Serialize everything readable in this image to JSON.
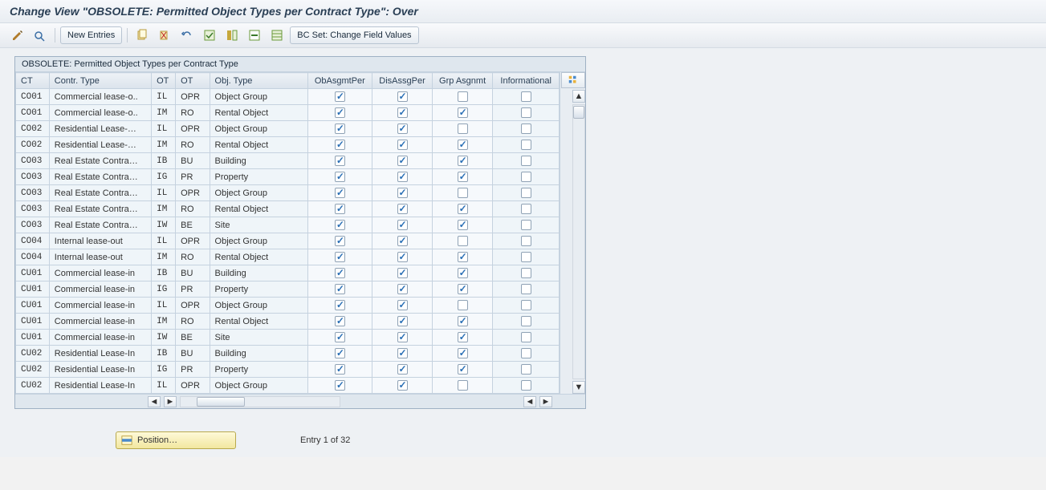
{
  "title": "Change View \"OBSOLETE: Permitted Object Types per Contract Type\": Over",
  "toolbar": {
    "new_entries": "New Entries",
    "bcset": "BC Set: Change Field Values"
  },
  "panel_title": "OBSOLETE: Permitted Object Types per Contract Type",
  "columns": {
    "ct": "CT",
    "contr_type": "Contr. Type",
    "ot1": "OT",
    "ot2": "OT",
    "obj_type": "Obj. Type",
    "obAsgmtPer": "ObAsgmtPer",
    "disAssgPer": "DisAssgPer",
    "grpAsgnmt": "Grp Asgnmt",
    "informational": "Informational"
  },
  "rows": [
    {
      "ct": "CO01",
      "ctype": "Commercial lease-o..",
      "ot1": "IL",
      "ot2": "OPR",
      "otype": "Object Group",
      "c1": true,
      "c2": true,
      "c3": false,
      "c4": false
    },
    {
      "ct": "CO01",
      "ctype": "Commercial lease-o..",
      "ot1": "IM",
      "ot2": "RO",
      "otype": "Rental Object",
      "c1": true,
      "c2": true,
      "c3": true,
      "c4": false
    },
    {
      "ct": "CO02",
      "ctype": "Residential Lease-…",
      "ot1": "IL",
      "ot2": "OPR",
      "otype": "Object Group",
      "c1": true,
      "c2": true,
      "c3": false,
      "c4": false
    },
    {
      "ct": "CO02",
      "ctype": "Residential Lease-…",
      "ot1": "IM",
      "ot2": "RO",
      "otype": "Rental Object",
      "c1": true,
      "c2": true,
      "c3": true,
      "c4": false
    },
    {
      "ct": "CO03",
      "ctype": "Real Estate Contra…",
      "ot1": "IB",
      "ot2": "BU",
      "otype": "Building",
      "c1": true,
      "c2": true,
      "c3": true,
      "c4": false
    },
    {
      "ct": "CO03",
      "ctype": "Real Estate Contra…",
      "ot1": "IG",
      "ot2": "PR",
      "otype": "Property",
      "c1": true,
      "c2": true,
      "c3": true,
      "c4": false
    },
    {
      "ct": "CO03",
      "ctype": "Real Estate Contra…",
      "ot1": "IL",
      "ot2": "OPR",
      "otype": "Object Group",
      "c1": true,
      "c2": true,
      "c3": false,
      "c4": false
    },
    {
      "ct": "CO03",
      "ctype": "Real Estate Contra…",
      "ot1": "IM",
      "ot2": "RO",
      "otype": "Rental Object",
      "c1": true,
      "c2": true,
      "c3": true,
      "c4": false
    },
    {
      "ct": "CO03",
      "ctype": "Real Estate Contra…",
      "ot1": "IW",
      "ot2": "BE",
      "otype": "Site",
      "c1": true,
      "c2": true,
      "c3": true,
      "c4": false
    },
    {
      "ct": "CO04",
      "ctype": "Internal lease-out",
      "ot1": "IL",
      "ot2": "OPR",
      "otype": "Object Group",
      "c1": true,
      "c2": true,
      "c3": false,
      "c4": false
    },
    {
      "ct": "CO04",
      "ctype": "Internal lease-out",
      "ot1": "IM",
      "ot2": "RO",
      "otype": "Rental Object",
      "c1": true,
      "c2": true,
      "c3": true,
      "c4": false
    },
    {
      "ct": "CU01",
      "ctype": "Commercial lease-in",
      "ot1": "IB",
      "ot2": "BU",
      "otype": "Building",
      "c1": true,
      "c2": true,
      "c3": true,
      "c4": false
    },
    {
      "ct": "CU01",
      "ctype": "Commercial lease-in",
      "ot1": "IG",
      "ot2": "PR",
      "otype": "Property",
      "c1": true,
      "c2": true,
      "c3": true,
      "c4": false
    },
    {
      "ct": "CU01",
      "ctype": "Commercial lease-in",
      "ot1": "IL",
      "ot2": "OPR",
      "otype": "Object Group",
      "c1": true,
      "c2": true,
      "c3": false,
      "c4": false
    },
    {
      "ct": "CU01",
      "ctype": "Commercial lease-in",
      "ot1": "IM",
      "ot2": "RO",
      "otype": "Rental Object",
      "c1": true,
      "c2": true,
      "c3": true,
      "c4": false
    },
    {
      "ct": "CU01",
      "ctype": "Commercial lease-in",
      "ot1": "IW",
      "ot2": "BE",
      "otype": "Site",
      "c1": true,
      "c2": true,
      "c3": true,
      "c4": false
    },
    {
      "ct": "CU02",
      "ctype": "Residential Lease-In",
      "ot1": "IB",
      "ot2": "BU",
      "otype": "Building",
      "c1": true,
      "c2": true,
      "c3": true,
      "c4": false
    },
    {
      "ct": "CU02",
      "ctype": "Residential Lease-In",
      "ot1": "IG",
      "ot2": "PR",
      "otype": "Property",
      "c1": true,
      "c2": true,
      "c3": true,
      "c4": false
    },
    {
      "ct": "CU02",
      "ctype": "Residential Lease-In",
      "ot1": "IL",
      "ot2": "OPR",
      "otype": "Object Group",
      "c1": true,
      "c2": true,
      "c3": false,
      "c4": false
    }
  ],
  "footer": {
    "position_label": "Position…",
    "entry_text": "Entry 1 of 32"
  }
}
